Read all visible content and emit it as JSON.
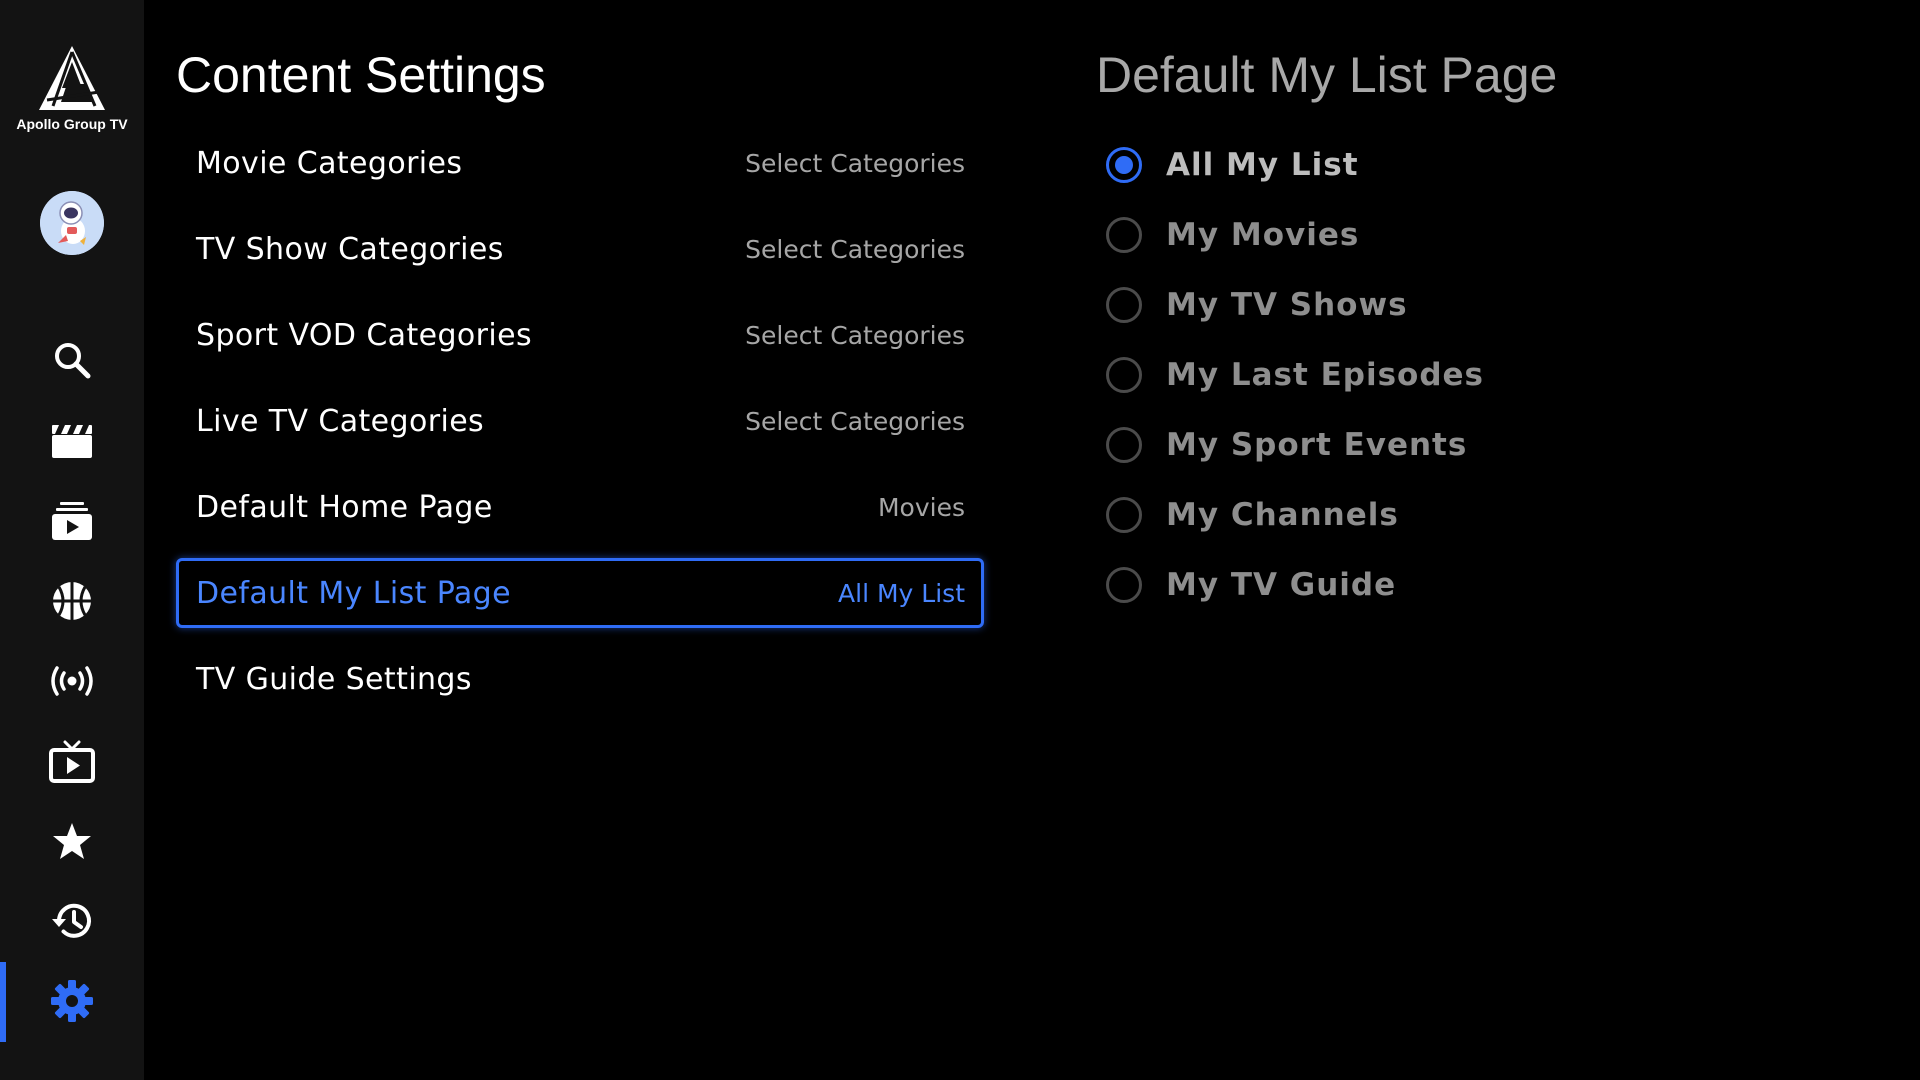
{
  "app": {
    "name": "Apollo Group TV"
  },
  "sidebar": {
    "items": [
      {
        "id": "search",
        "icon": "search-icon"
      },
      {
        "id": "movies",
        "icon": "clapperboard-icon"
      },
      {
        "id": "tv-shows",
        "icon": "playlist-play-icon"
      },
      {
        "id": "sports",
        "icon": "basketball-icon"
      },
      {
        "id": "live-tv",
        "icon": "broadcast-icon"
      },
      {
        "id": "tv-guide",
        "icon": "tv-play-icon"
      },
      {
        "id": "favorites",
        "icon": "star-icon"
      },
      {
        "id": "history",
        "icon": "history-icon"
      },
      {
        "id": "settings",
        "icon": "gear-icon",
        "active": true
      }
    ],
    "active_color": "#2f6cf6"
  },
  "main": {
    "title": "Content Settings",
    "rows": [
      {
        "label": "Movie Categories",
        "value": "Select Categories"
      },
      {
        "label": "TV Show Categories",
        "value": "Select Categories"
      },
      {
        "label": "Sport VOD Categories",
        "value": "Select Categories"
      },
      {
        "label": "Live TV Categories",
        "value": "Select Categories"
      },
      {
        "label": "Default Home Page",
        "value": "Movies"
      },
      {
        "label": "Default My List Page",
        "value": "All My List",
        "selected": true
      },
      {
        "label": "TV Guide Settings",
        "value": ""
      }
    ]
  },
  "panel": {
    "title": "Default My List Page",
    "options": [
      {
        "label": "All My List",
        "checked": true
      },
      {
        "label": "My Movies",
        "checked": false
      },
      {
        "label": "My TV Shows",
        "checked": false
      },
      {
        "label": "My Last Episodes",
        "checked": false
      },
      {
        "label": "My Sport Events",
        "checked": false
      },
      {
        "label": "My Channels",
        "checked": false
      },
      {
        "label": "My TV Guide",
        "checked": false
      }
    ]
  },
  "colors": {
    "background": "#000000",
    "sidebar": "#131313",
    "accent": "#2f6cf6",
    "selected_text": "#4a86ff"
  }
}
